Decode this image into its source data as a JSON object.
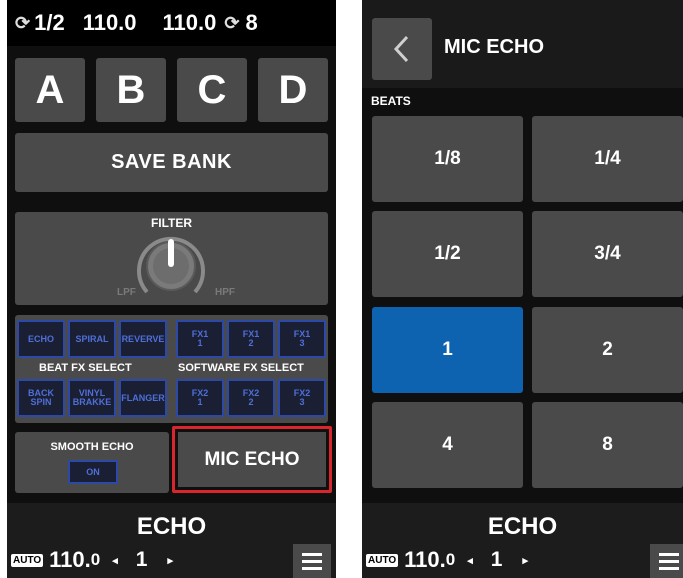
{
  "left": {
    "status": {
      "beat": "1/2",
      "bpm_left": "110.0",
      "bpm_right": "110.0",
      "value_right": "8"
    },
    "banks": [
      "A",
      "B",
      "C",
      "D"
    ],
    "save_bank": "SAVE BANK",
    "filter": {
      "title": "FILTER",
      "lpf": "LPF",
      "hpf": "HPF"
    },
    "beat_fx": {
      "label": "BEAT FX SELECT",
      "row1": [
        "ECHO",
        "SPIRAL",
        "REVERVE"
      ],
      "row2": [
        [
          "BACK",
          "SPIN"
        ],
        [
          "VINYL",
          "BRAKKE"
        ],
        [
          "FLANGER"
        ]
      ]
    },
    "software_fx": {
      "label": "SOFTWARE FX SELECT",
      "row1": [
        [
          "FX1",
          "1"
        ],
        [
          "FX1",
          "2"
        ],
        [
          "FX1",
          "3"
        ]
      ],
      "row2": [
        [
          "FX2",
          "1"
        ],
        [
          "FX2",
          "2"
        ],
        [
          "FX2",
          "3"
        ]
      ]
    },
    "smooth_echo": {
      "title": "SMOOTH ECHO",
      "state": "ON"
    },
    "mic_echo": "MIC ECHO",
    "bottom": {
      "title": "ECHO",
      "auto": "AUTO",
      "bpm_int": "110.",
      "bpm_dec": "0",
      "jump": "1"
    }
  },
  "right": {
    "title": "MIC ECHO",
    "beats_label": "BEATS",
    "beats": [
      "1/8",
      "1/4",
      "1/2",
      "3/4",
      "1",
      "2",
      "4",
      "8"
    ],
    "active_beat": "1",
    "bottom": {
      "title": "ECHO",
      "auto": "AUTO",
      "bpm_int": "110.",
      "bpm_dec": "0",
      "jump": "1"
    }
  },
  "colors": {
    "accent_blue": "#0e63b0",
    "fx_blue": "#2c49a8",
    "highlight_red": "#d9262c",
    "button_grey": "#4a4a4a"
  },
  "icons": {
    "sync": "sync-icon",
    "back": "chevron-left-icon",
    "menu": "hamburger-menu-icon",
    "knob": "filter-knob"
  }
}
